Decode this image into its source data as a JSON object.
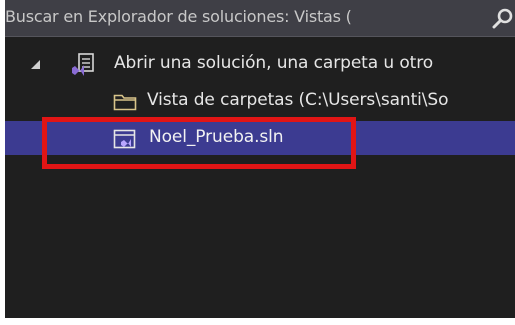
{
  "search": {
    "placeholder": "Buscar en Explorador de soluciones: Vistas ("
  },
  "tree": {
    "root": {
      "label": "Abrir una solución, una carpeta u otro",
      "icon": "visual-studio-icon",
      "expanded": true
    },
    "folder_view": {
      "label": "Vista de carpetas (C:\\Users\\santi\\So",
      "icon": "folder-icon"
    },
    "solution_file": {
      "label": "Noel_Prueba.sln",
      "icon": "solution-file-icon",
      "selected": true
    }
  },
  "colors": {
    "panel_bg": "#1f1f1f",
    "searchbar_bg": "#3f3f46",
    "selection_bg": "#3c3b91",
    "highlight_box": "#e11515"
  }
}
